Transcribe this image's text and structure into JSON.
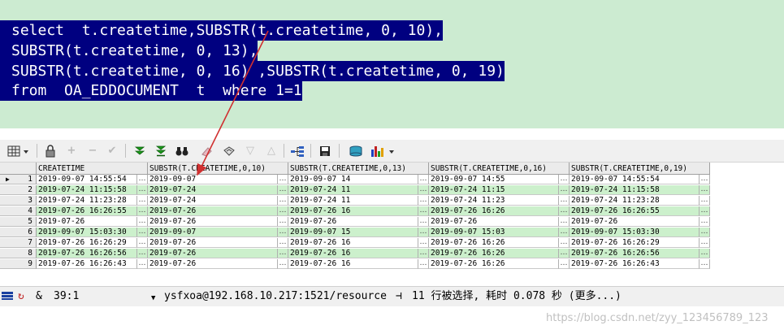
{
  "editor": {
    "lines": [
      "select  t.createtime,SUBSTR(t.createtime, 0, 10),",
      "SUBSTR(t.createtime, 0, 13),",
      "SUBSTR(t.createtime, 0, 16) ,SUBSTR(t.createtime, 0, 19)",
      "from  OA_EDDOCUMENT  t  where 1=1"
    ]
  },
  "grid": {
    "columns": [
      "CREATETIME",
      "SUBSTR(T.CREATETIME,0,10)",
      "SUBSTR(T.CREATETIME,0,13)",
      "SUBSTR(T.CREATETIME,0,16)",
      "SUBSTR(T.CREATETIME,0,19)"
    ],
    "rows": [
      {
        "num": "1",
        "cells": [
          "2019-09-07 14:55:54",
          "2019-09-07",
          "2019-09-07 14",
          "2019-09-07 14:55",
          "2019-09-07 14:55:54"
        ]
      },
      {
        "num": "2",
        "cells": [
          "2019-07-24 11:15:58",
          "2019-07-24",
          "2019-07-24 11",
          "2019-07-24 11:15",
          "2019-07-24 11:15:58"
        ]
      },
      {
        "num": "3",
        "cells": [
          "2019-07-24 11:23:28",
          "2019-07-24",
          "2019-07-24 11",
          "2019-07-24 11:23",
          "2019-07-24 11:23:28"
        ]
      },
      {
        "num": "4",
        "cells": [
          "2019-07-26 16:26:55",
          "2019-07-26",
          "2019-07-26 16",
          "2019-07-26 16:26",
          "2019-07-26 16:26:55"
        ]
      },
      {
        "num": "5",
        "cells": [
          "2019-07-26",
          "2019-07-26",
          "2019-07-26",
          "2019-07-26",
          "2019-07-26"
        ]
      },
      {
        "num": "6",
        "cells": [
          "2019-09-07 15:03:30",
          "2019-09-07",
          "2019-09-07 15",
          "2019-09-07 15:03",
          "2019-09-07 15:03:30"
        ]
      },
      {
        "num": "7",
        "cells": [
          "2019-07-26 16:26:29",
          "2019-07-26",
          "2019-07-26 16",
          "2019-07-26 16:26",
          "2019-07-26 16:26:29"
        ]
      },
      {
        "num": "8",
        "cells": [
          "2019-07-26 16:26:56",
          "2019-07-26",
          "2019-07-26 16",
          "2019-07-26 16:26",
          "2019-07-26 16:26:56"
        ]
      },
      {
        "num": "9",
        "cells": [
          "2019-07-26 16:26:43",
          "2019-07-26",
          "2019-07-26 16",
          "2019-07-26 16:26",
          "2019-07-26 16:26:43"
        ]
      }
    ],
    "ellipsis": "…"
  },
  "status": {
    "ampersand": "&",
    "position": "39:1",
    "connection": "ysfxoa@192.168.10.217:1521/resource",
    "message": "11 行被选择, 耗时 0.078 秒 (更多...)"
  },
  "watermark": "https://blog.csdn.net/zyy_123456789_123",
  "colors": {
    "selection": "#000080",
    "editor_bg": "#ccebd1",
    "row_green": "#ccf0cc",
    "arrow": "#d03030"
  },
  "toolbar_icons": [
    "grid-icon",
    "lock-icon",
    "plus-icon",
    "minus-icon",
    "check-icon",
    "fetch-next-icon",
    "fetch-last-icon",
    "binoculars-icon",
    "eraser-icon",
    "print-icon",
    "filter-down-icon",
    "filter-up-icon",
    "tree-icon",
    "save-icon",
    "database-icon",
    "chart-icon"
  ]
}
